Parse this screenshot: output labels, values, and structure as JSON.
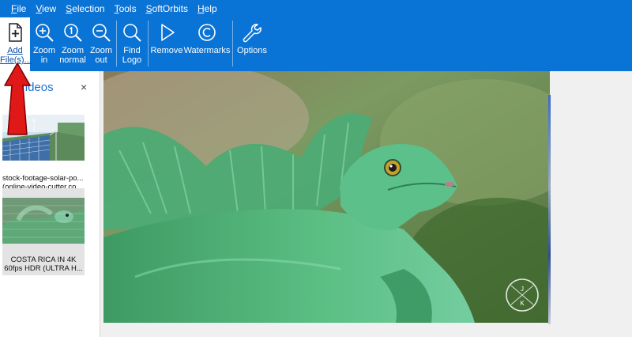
{
  "menu": [
    "File",
    "View",
    "Selection",
    "Tools",
    "SoftOrbits",
    "Help"
  ],
  "toolbar": {
    "add_files": "Add File(s)...",
    "zoom_in": "Zoom in",
    "zoom_normal": "Zoom normal",
    "zoom_out": "Zoom out",
    "find_logo": "Find Logo",
    "remove": "Remove",
    "watermarks": "Watermarks",
    "options": "Options"
  },
  "panel": {
    "title": "Videos",
    "close": "×",
    "items": [
      {
        "caption_line1": "stock-footage-solar-po...",
        "caption_line2": "(online-video-cutter.co..."
      },
      {
        "caption_line1": "COSTA RICA IN 4K",
        "caption_line2": "60fps HDR (ULTRA H..."
      }
    ]
  },
  "preview": {
    "watermark_letters": [
      "J",
      "K"
    ]
  },
  "colors": {
    "accent": "#0a73d6",
    "panel_title": "#1e6fd0",
    "arrow": "#e01818"
  }
}
